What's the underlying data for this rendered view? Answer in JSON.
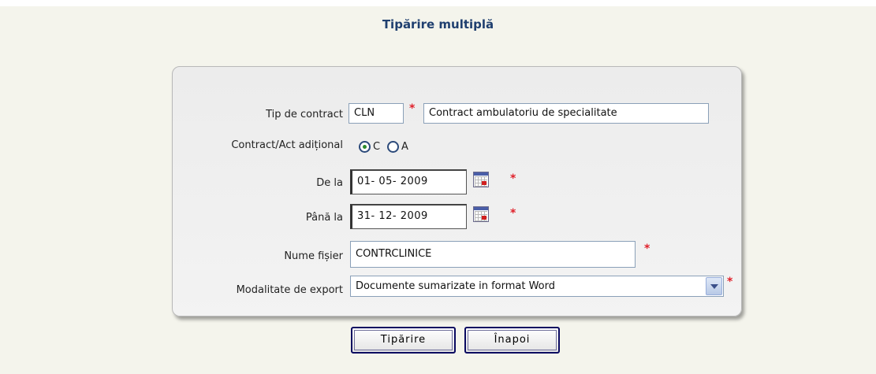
{
  "title": "Tipărire multiplă",
  "form": {
    "tip_contract": {
      "label": "Tip de contract",
      "code": "CLN",
      "name": "Contract ambulatoriu de specialitate"
    },
    "contract_act": {
      "label": "Contract/Act adițional",
      "options": [
        "C",
        "A"
      ],
      "selected": "C"
    },
    "de_la": {
      "label": "De la",
      "value": "01- 05-  2009"
    },
    "pana_la": {
      "label": "Până la",
      "value": "31- 12-  2009"
    },
    "nume_fisier": {
      "label": "Nume fișier",
      "value": "CONTRCLINICE"
    },
    "modalitate": {
      "label": "Modalitate de export",
      "value": "Documente sumarizate in format Word"
    },
    "required_mark": "*"
  },
  "buttons": {
    "print": "Tipărire",
    "back": "Înapoi"
  },
  "icons": {
    "calendar": "calendar-icon",
    "dropdown": "chevron-down-icon"
  }
}
